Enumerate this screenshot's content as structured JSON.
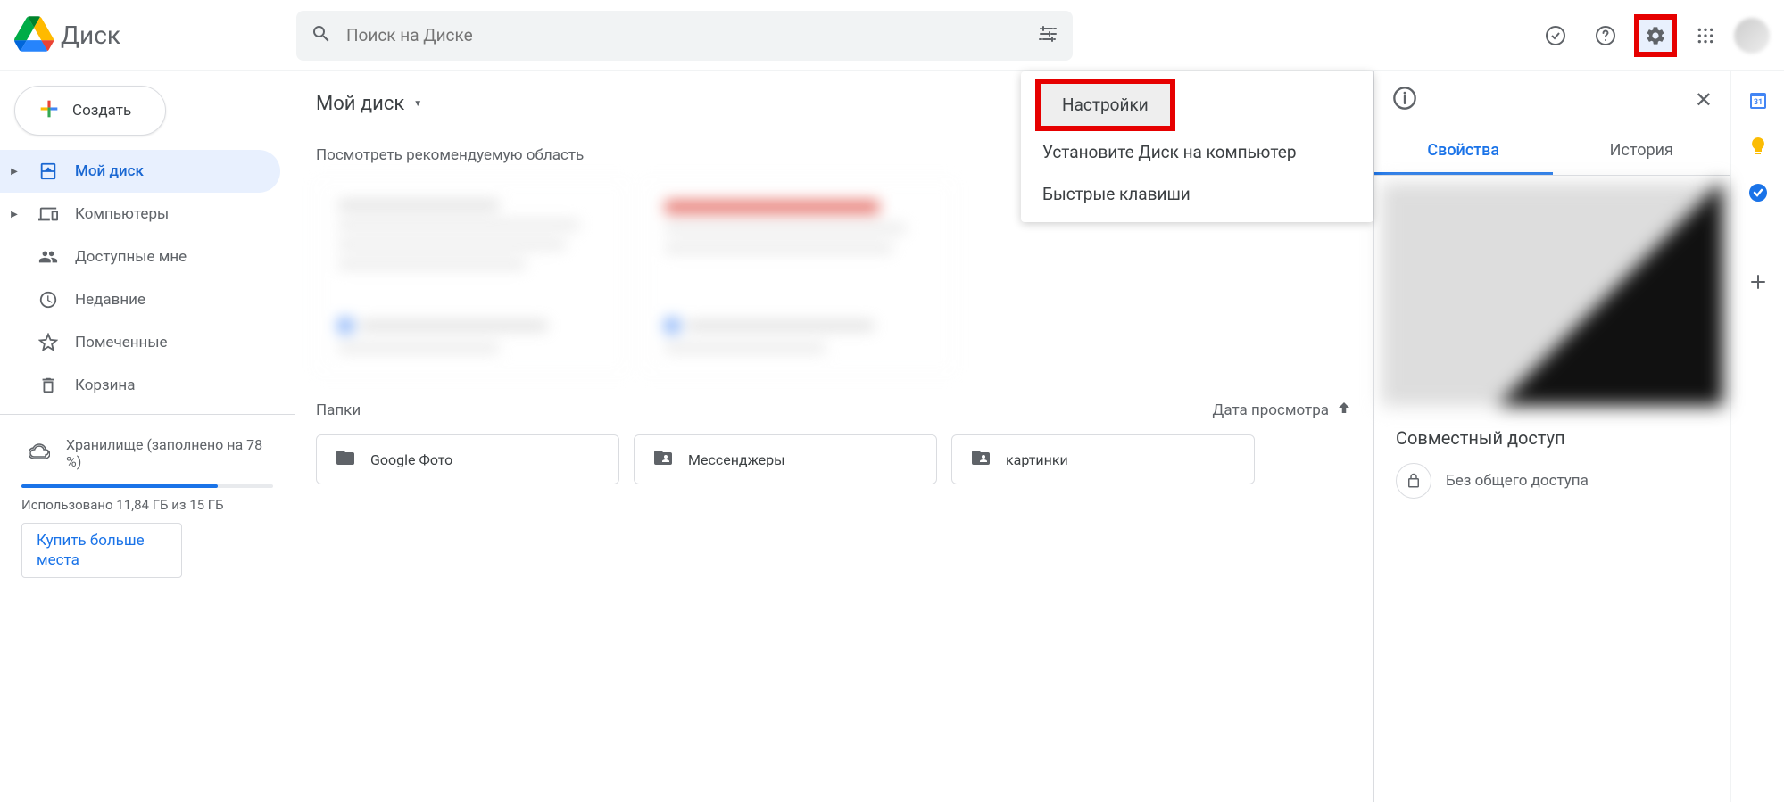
{
  "header": {
    "app_name": "Диск",
    "search_placeholder": "Поиск на Диске"
  },
  "sidebar": {
    "create_label": "Создать",
    "items": [
      {
        "label": "Мой диск",
        "icon": "drive",
        "expandable": true,
        "active": true
      },
      {
        "label": "Компьютеры",
        "icon": "computers",
        "expandable": true,
        "active": false
      },
      {
        "label": "Доступные мне",
        "icon": "shared",
        "expandable": false,
        "active": false
      },
      {
        "label": "Недавние",
        "icon": "recent",
        "expandable": false,
        "active": false
      },
      {
        "label": "Помеченные",
        "icon": "starred",
        "expandable": false,
        "active": false
      },
      {
        "label": "Корзина",
        "icon": "trash",
        "expandable": false,
        "active": false
      }
    ],
    "storage": {
      "label": "Хранилище (заполнено на 78 %)",
      "percent": 78,
      "used_text": "Использовано 11,84 ГБ из 15 ГБ",
      "buy_label": "Купить больше места"
    }
  },
  "main": {
    "breadcrumb": "Мой диск",
    "recommend_text": "Посмотреть рекомендуемую область",
    "folders_header": "Папки",
    "sort_label": "Дата просмотра",
    "folders": [
      {
        "name": "Google Фото",
        "shared": false
      },
      {
        "name": "Мессенджеры",
        "shared": true
      },
      {
        "name": "картинки",
        "shared": true
      }
    ]
  },
  "settings_menu": {
    "items": [
      "Настройки",
      "Установите Диск на компьютер",
      "Быстрые клавиши"
    ]
  },
  "right_panel": {
    "info_icon": "info",
    "tabs": {
      "properties": "Свойства",
      "history": "История"
    },
    "sharing_title": "Совместный доступ",
    "sharing_status": "Без общего доступа"
  }
}
